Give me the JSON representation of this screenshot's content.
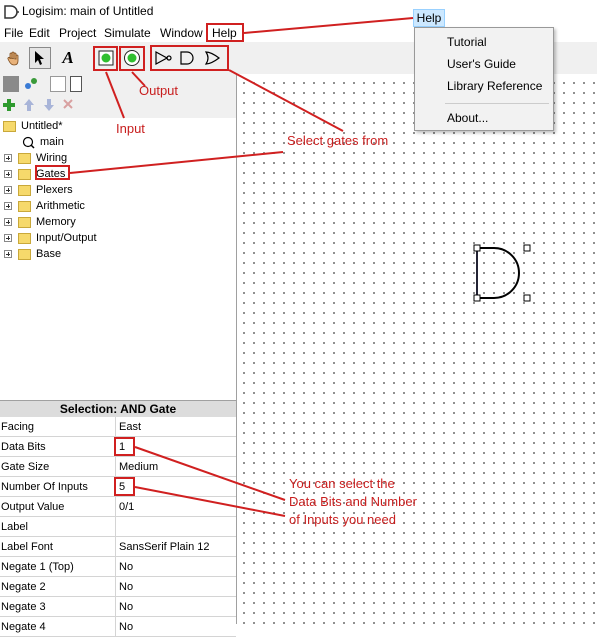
{
  "window": {
    "title": "Logisim: main of Untitled"
  },
  "menu": [
    "File",
    "Edit",
    "Project",
    "Simulate",
    "Window",
    "Help"
  ],
  "help_menu": {
    "tab_label": "Help",
    "items": [
      "Tutorial",
      "User's Guide",
      "Library Reference",
      "About..."
    ]
  },
  "tree": {
    "project": "Untitled*",
    "circuit": "main",
    "libraries": [
      "Wiring",
      "Gates",
      "Plexers",
      "Arithmetic",
      "Memory",
      "Input/Output",
      "Base"
    ]
  },
  "selection": {
    "header": "Selection: AND Gate",
    "attributes": [
      {
        "name": "Facing",
        "value": "East"
      },
      {
        "name": "Data Bits",
        "value": "1"
      },
      {
        "name": "Gate Size",
        "value": "Medium"
      },
      {
        "name": "Number Of Inputs",
        "value": "5"
      },
      {
        "name": "Output Value",
        "value": "0/1"
      },
      {
        "name": "Label",
        "value": ""
      },
      {
        "name": "Label Font",
        "value": "SansSerif Plain 12"
      },
      {
        "name": "Negate 1 (Top)",
        "value": "No"
      },
      {
        "name": "Negate 2",
        "value": "No"
      },
      {
        "name": "Negate 3",
        "value": "No"
      },
      {
        "name": "Negate 4",
        "value": "No"
      }
    ]
  },
  "annotations": {
    "input": "Input",
    "output": "Output",
    "select_gates": "Select gates from",
    "select_bits_line1": "You can select the",
    "select_bits_line2": "Data Bits and Number",
    "select_bits_line3": "of Inputs you need"
  },
  "colors": {
    "annotation": "#d02020",
    "pin_green": "#2fbf2f",
    "menu_highlight": "#cce8ff"
  }
}
